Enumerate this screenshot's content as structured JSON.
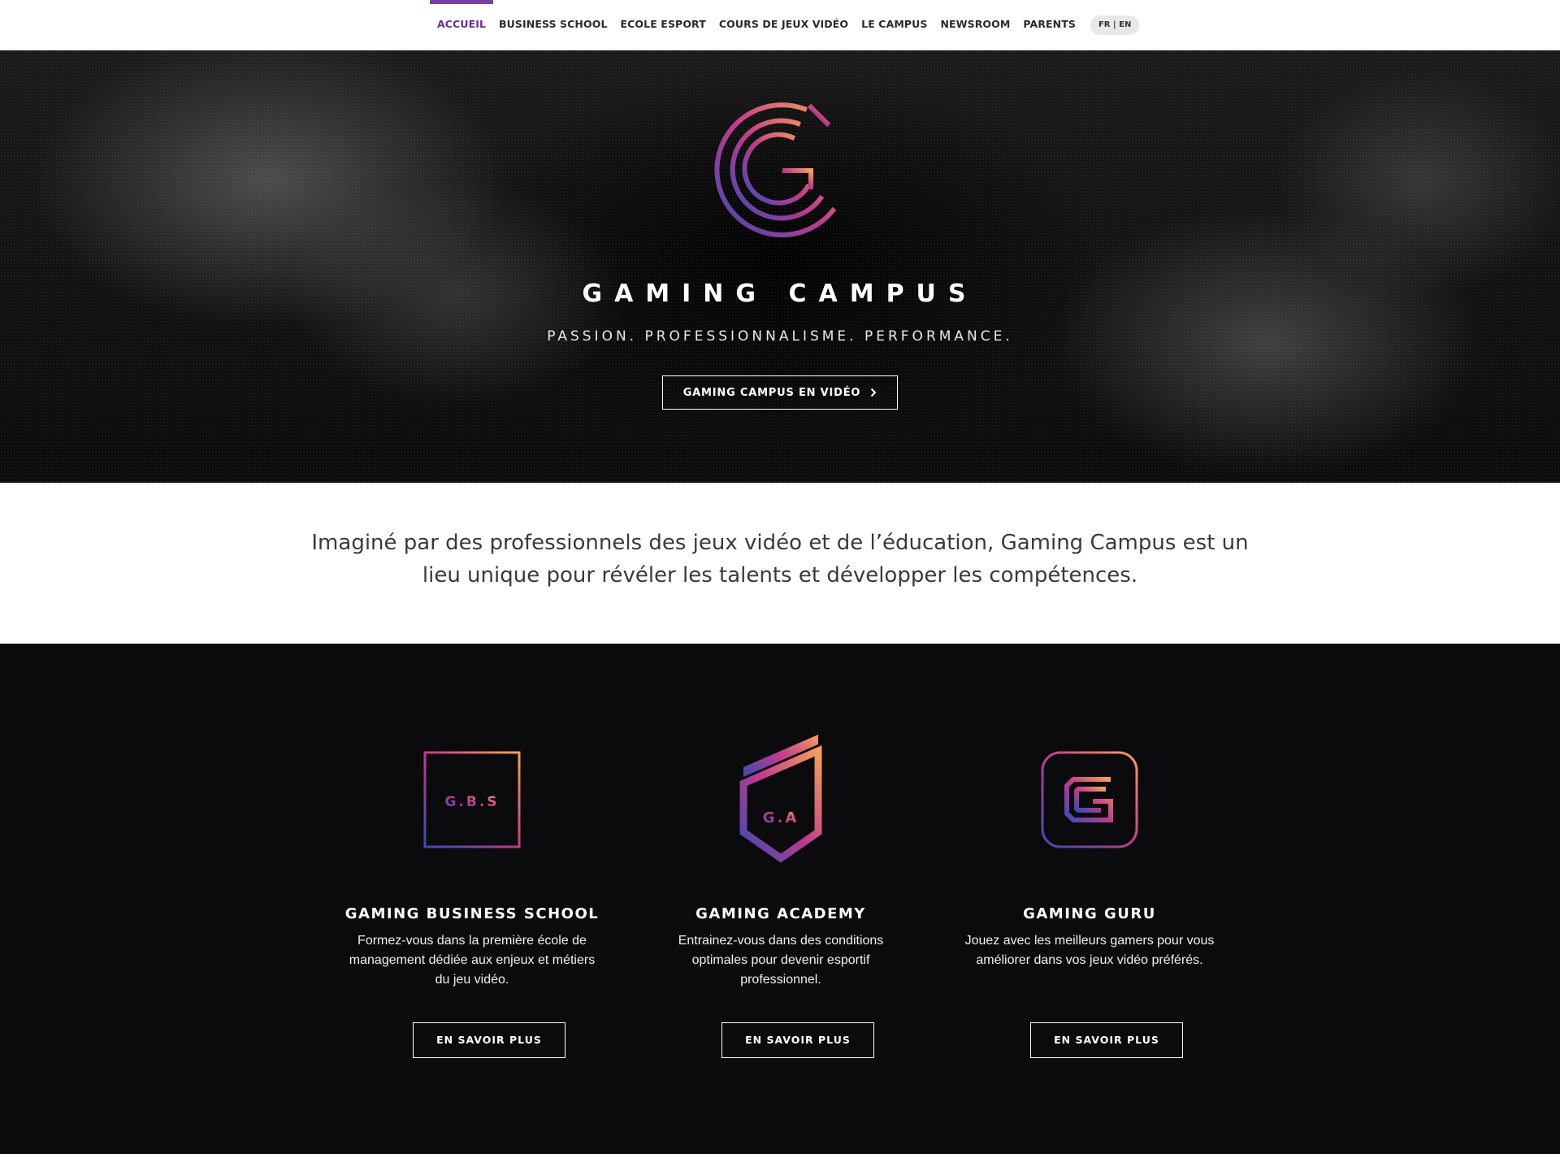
{
  "nav": {
    "items": [
      {
        "label": "ACCUEIL",
        "active": true
      },
      {
        "label": "BUSINESS SCHOOL",
        "active": false
      },
      {
        "label": "ECOLE ESPORT",
        "active": false
      },
      {
        "label": "COURS DE JEUX VIDÉO",
        "active": false
      },
      {
        "label": "LE CAMPUS",
        "active": false
      },
      {
        "label": "NEWSROOM",
        "active": false
      },
      {
        "label": "PARENTS",
        "active": false
      }
    ],
    "lang": "FR | EN"
  },
  "hero": {
    "logo_icon": "gaming-campus-logo-icon",
    "title": "GAMING CAMPUS",
    "tagline": "PASSION. PROFESSIONNALISME. PERFORMANCE.",
    "button_label": "GAMING CAMPUS EN VIDÉO",
    "button_icon": "chevron-right-icon"
  },
  "intro": {
    "text": "Imaginé par des professionnels des jeux vidéo et de l’éducation, Gaming Campus est un lieu unique pour révéler les talents et développer les compétences."
  },
  "programs": [
    {
      "icon": "gbs-logo-icon",
      "logo_text": "G.B.S",
      "title": "GAMING BUSINESS SCHOOL",
      "description": "Formez-vous dans la première école de management dédiée aux enjeux et métiers du jeu vidéo.",
      "button_label": "EN SAVOIR PLUS"
    },
    {
      "icon": "ga-logo-icon",
      "logo_text": "G.A",
      "title": "GAMING ACADEMY",
      "description": "Entrainez-vous dans des conditions optimales pour devenir esportif professionnel.",
      "button_label": "EN SAVOIR PLUS"
    },
    {
      "icon": "guru-logo-icon",
      "title": "GAMING GURU",
      "description": "Jouez avec les meilleurs gamers pour vous améliorer dans vos jeux vidéo préférés.",
      "button_label": "EN SAVOIR PLUS"
    }
  ],
  "colors": {
    "accent_purple": "#7b3fa2",
    "gradient_orange": "#f3a15a",
    "gradient_pink": "#c13a8c",
    "gradient_blue": "#3a4bb5",
    "dark_bg": "#0b0b0d"
  }
}
